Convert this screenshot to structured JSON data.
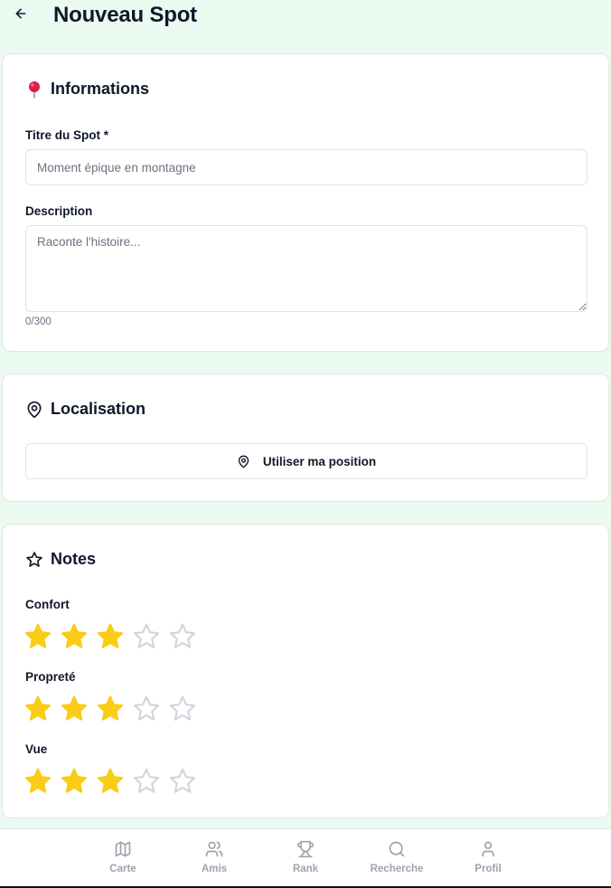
{
  "header": {
    "title": "Nouveau Spot"
  },
  "info": {
    "title": "Informations",
    "title_field": {
      "label": "Titre du Spot *",
      "placeholder": "Moment épique en montagne",
      "value": ""
    },
    "description_field": {
      "label": "Description",
      "placeholder": "Raconte l'histoire...",
      "value": ""
    },
    "counter": "0/300"
  },
  "location": {
    "title": "Localisation",
    "use_position_label": "Utiliser ma position"
  },
  "notes": {
    "title": "Notes",
    "ratings": [
      {
        "label": "Confort",
        "value": 3,
        "max": 5
      },
      {
        "label": "Propreté",
        "value": 3,
        "max": 5
      },
      {
        "label": "Vue",
        "value": 3,
        "max": 5
      }
    ]
  },
  "nav": {
    "items": [
      {
        "label": "Carte",
        "icon": "map-icon"
      },
      {
        "label": "Amis",
        "icon": "users-icon"
      },
      {
        "label": "Rank",
        "icon": "trophy-icon"
      },
      {
        "label": "Recherche",
        "icon": "search-icon"
      },
      {
        "label": "Profil",
        "icon": "user-icon"
      }
    ]
  },
  "colors": {
    "background": "#ecfbf2",
    "star_filled": "#facc15",
    "star_empty": "#d1d5db",
    "nav_inactive": "#9ca3af",
    "pin": "#e11d48"
  }
}
